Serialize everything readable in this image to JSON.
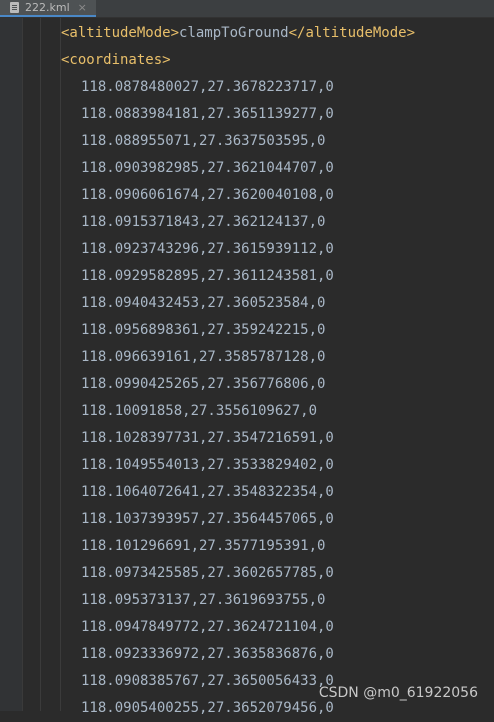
{
  "tab": {
    "filename": "222.kml",
    "close_glyph": "×",
    "icon": "file-icon"
  },
  "code": {
    "altitude_open": "<altitudeMode>",
    "altitude_value": "clampToGround",
    "altitude_close": "</altitudeMode>",
    "coordinates_tag": "<coordinates>",
    "coordinates": [
      "118.0878480027,27.3678223717,0",
      "118.0883984181,27.3651139277,0",
      "118.088955071,27.3637503595,0",
      "118.0903982985,27.3621044707,0",
      "118.0906061674,27.3620040108,0",
      "118.0915371843,27.362124137,0",
      "118.0923743296,27.3615939112,0",
      "118.0929582895,27.3611243581,0",
      "118.0940432453,27.360523584,0",
      "118.0956898361,27.359242215,0",
      "118.096639161,27.3585787128,0",
      "118.0990425265,27.356776806,0",
      "118.10091858,27.3556109627,0",
      "118.1028397731,27.3547216591,0",
      "118.1049554013,27.3533829402,0",
      "118.1064072641,27.3548322354,0",
      "118.1037393957,27.3564457065,0",
      "118.101296691,27.3577195391,0",
      "118.0973425585,27.3602657785,0",
      "118.095373137,27.3619693755,0",
      "118.0947849772,27.3624721104,0",
      "118.0923336972,27.3635836876,0",
      "118.0908385767,27.3650056433,0",
      "118.0905400255,27.3652079456,0"
    ]
  },
  "watermark": "CSDN @m0_61922056",
  "colors": {
    "background": "#2b2b2b",
    "tag": "#e8bf6a",
    "text": "#a9b7c6"
  }
}
